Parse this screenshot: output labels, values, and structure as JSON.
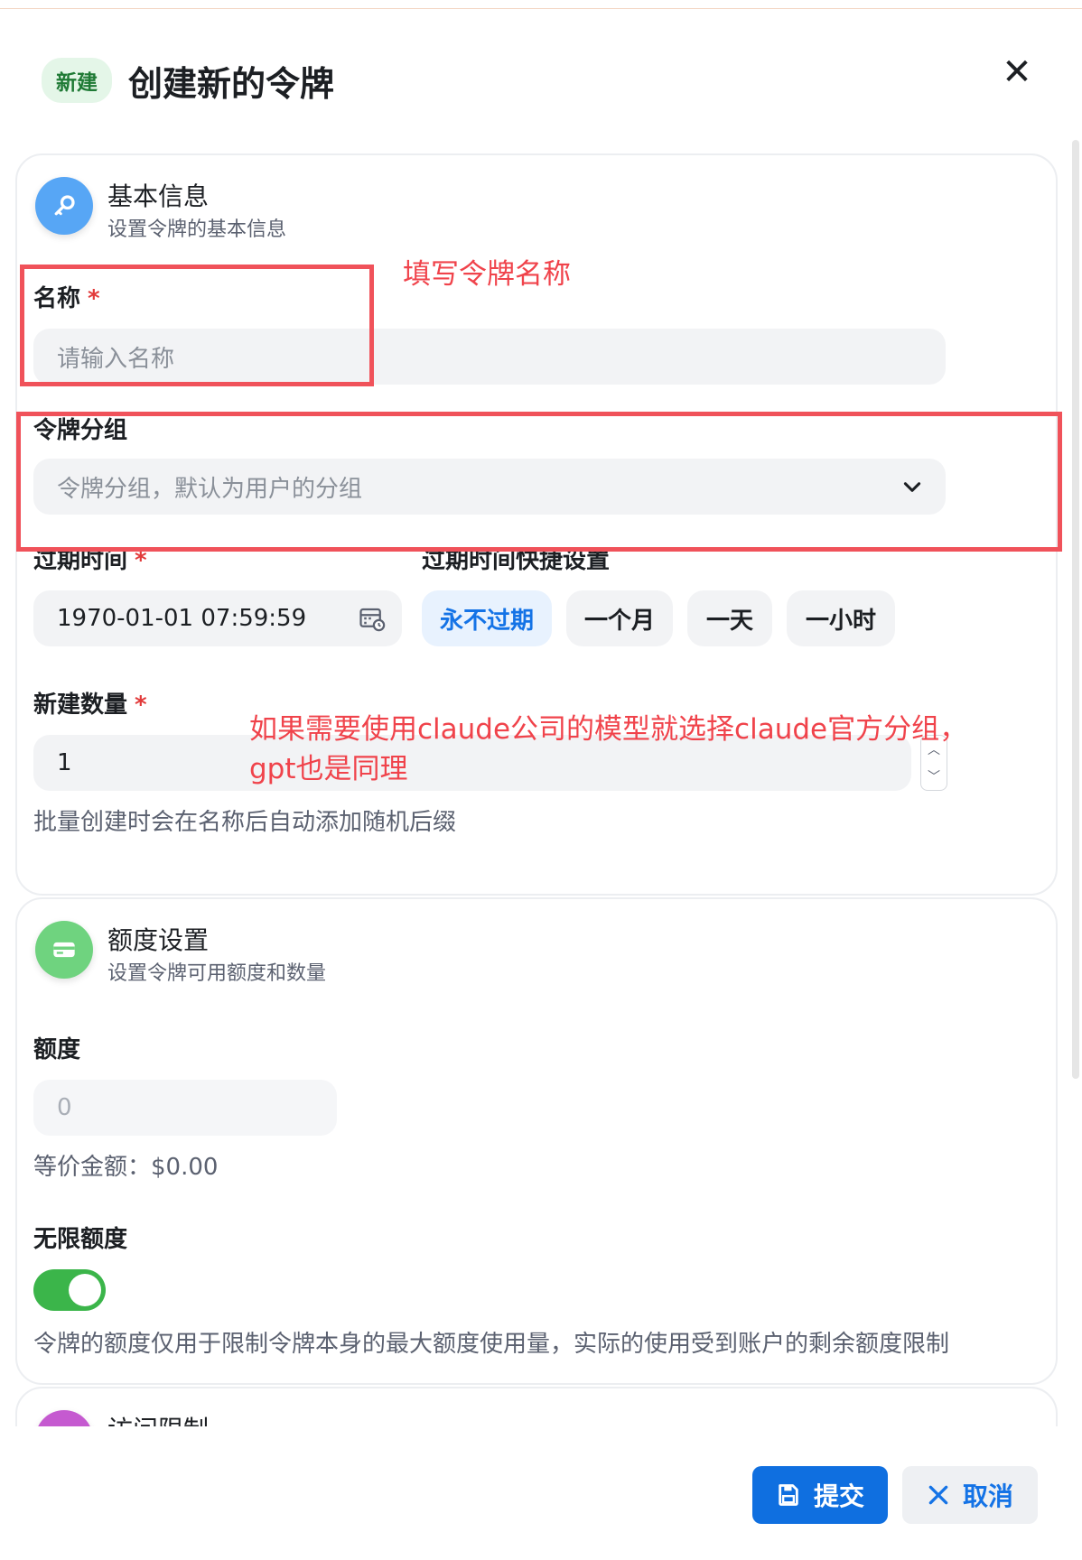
{
  "header": {
    "tag": "新建",
    "title": "创建新的令牌",
    "close_symbol": "✕"
  },
  "basic": {
    "title": "基本信息",
    "subtitle": "设置令牌的基本信息",
    "icon": "key-icon",
    "name_label": "名称",
    "name_placeholder": "请输入名称",
    "group_label": "令牌分组",
    "group_placeholder": "令牌分组，默认为用户的分组",
    "expire_label": "过期时间",
    "expire_value": "1970-01-01 07:59:59",
    "quick_label": "过期时间快捷设置",
    "quick": [
      {
        "label": "永不过期",
        "active": true
      },
      {
        "label": "一个月",
        "active": false
      },
      {
        "label": "一天",
        "active": false
      },
      {
        "label": "一小时",
        "active": false
      }
    ],
    "count_label": "新建数量",
    "count_value": "1",
    "count_hint": "批量创建时会在名称后自动添加随机后缀",
    "required_mark": "*"
  },
  "quota": {
    "title": "额度设置",
    "subtitle": "设置令牌可用额度和数量",
    "icon": "credit-card-icon",
    "quota_label": "额度",
    "quota_placeholder": "0",
    "equivalent": "等价金额：$0.00",
    "unlimited_label": "无限额度",
    "unlimited_on": true,
    "unlimited_hint": "令牌的额度仅用于限制令牌本身的最大额度使用量，实际的使用受到账户的剩余额度限制"
  },
  "access": {
    "title": "访问限制"
  },
  "annotations": {
    "name_note": "填写令牌名称",
    "group_note_line1": "如果需要使用claude公司的模型就选择claude官方分组，",
    "group_note_line2": "gpt也是同理"
  },
  "footer": {
    "submit": "提交",
    "cancel": "取消"
  },
  "colors": {
    "primary": "#0f6fe0",
    "annotation_red": "#f0525a",
    "toggle_green": "#3bb54a"
  }
}
